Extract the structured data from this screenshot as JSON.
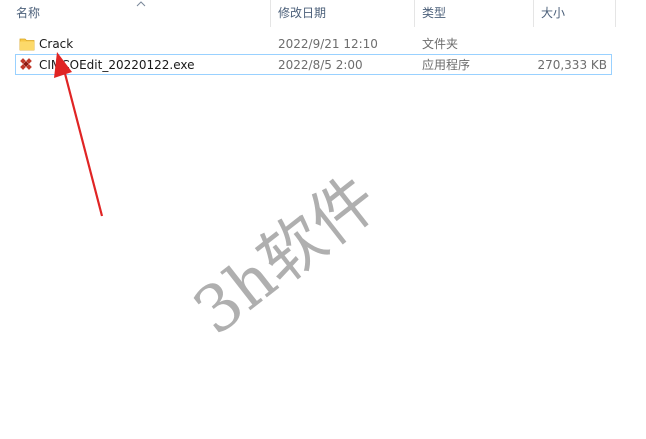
{
  "columns": {
    "name": "名称",
    "modified": "修改日期",
    "type": "类型",
    "size": "大小"
  },
  "rows": [
    {
      "name": "Crack",
      "modified": "2022/9/21 12:10",
      "type": "文件夹",
      "size": "",
      "icon": "folder-icon"
    },
    {
      "name": "CIMCOEdit_20220122.exe",
      "modified": "2022/8/5 2:00",
      "type": "应用程序",
      "size": "270,333 KB",
      "icon": "exe-app-icon"
    }
  ],
  "watermark": "3h软件",
  "colors": {
    "header_text": "#4c607a",
    "selection_border": "#99d1ff",
    "arrow": "#e02424",
    "folder": "#f7c948"
  }
}
